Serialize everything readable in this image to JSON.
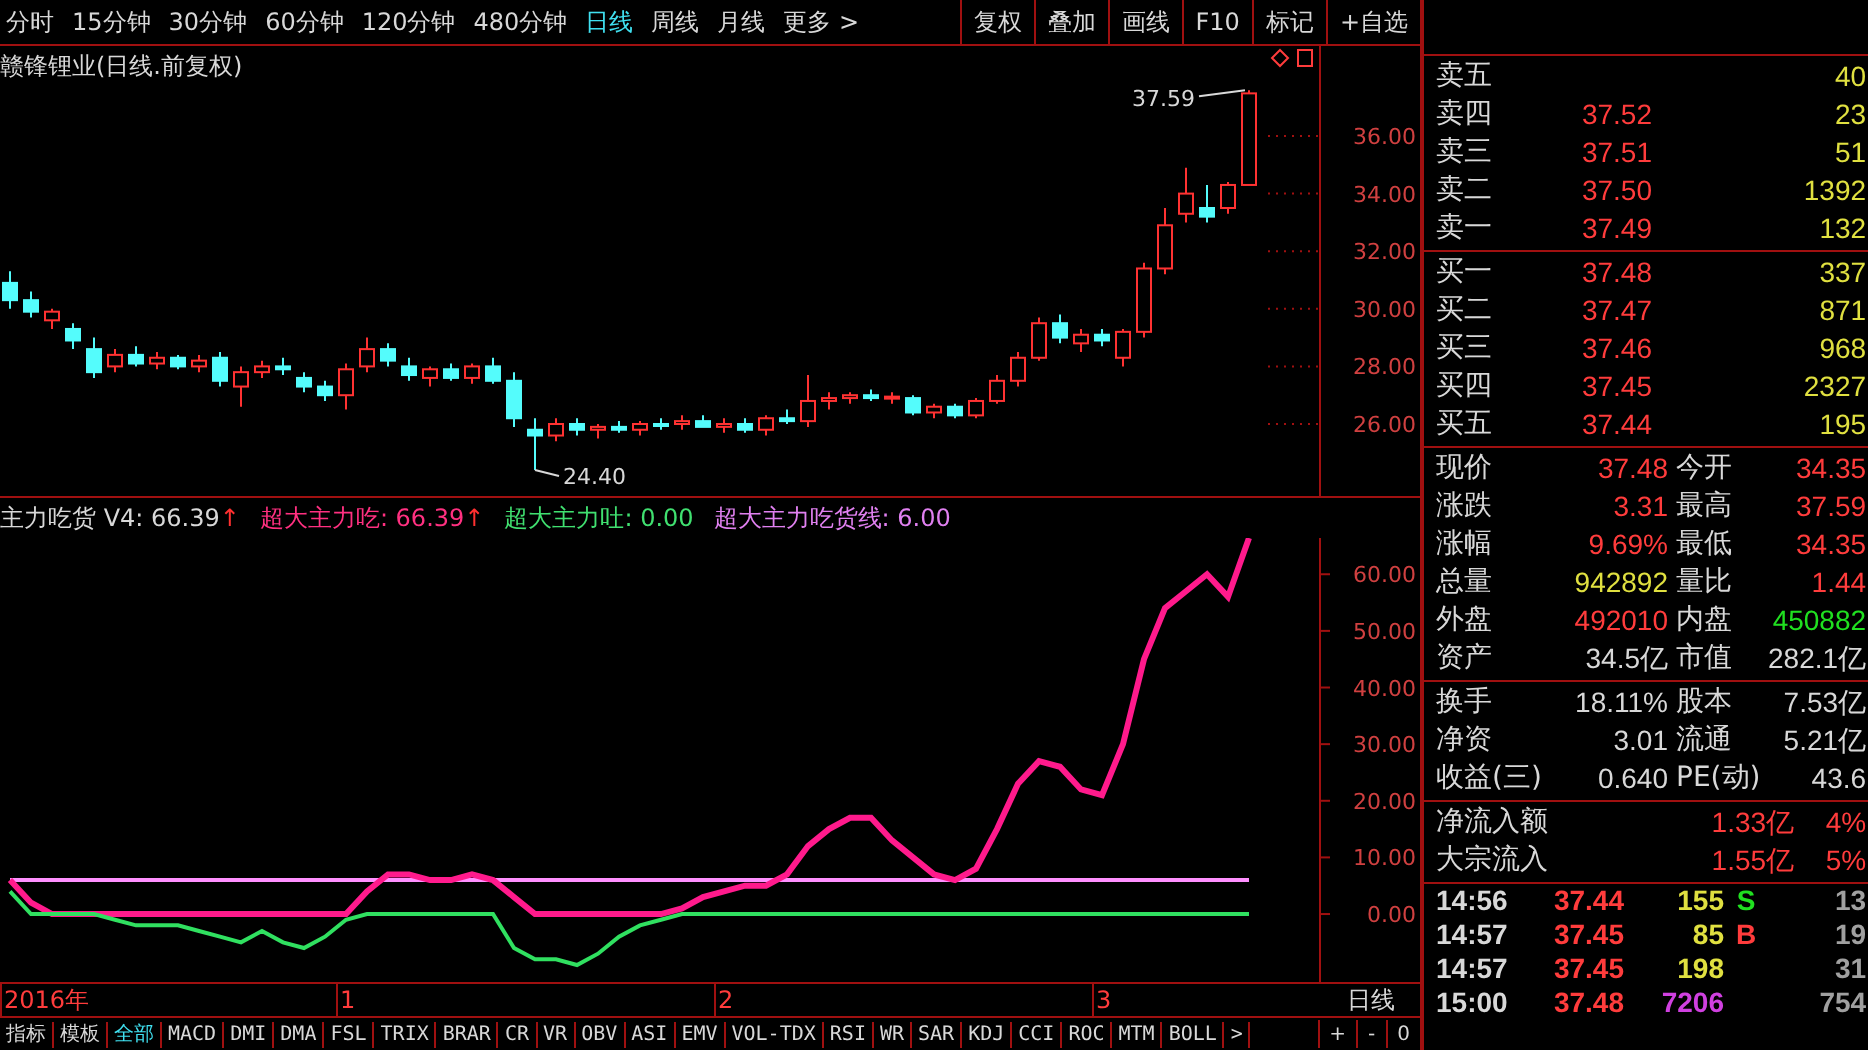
{
  "toolbar": {
    "periods": [
      {
        "label": "分时",
        "selected": false
      },
      {
        "label": "15分钟",
        "selected": false
      },
      {
        "label": "30分钟",
        "selected": false
      },
      {
        "label": "60分钟",
        "selected": false
      },
      {
        "label": "120分钟",
        "selected": false
      },
      {
        "label": "480分钟",
        "selected": false
      },
      {
        "label": "日线",
        "selected": true
      },
      {
        "label": "周线",
        "selected": false
      },
      {
        "label": "月线",
        "selected": false
      },
      {
        "label": "更多 >",
        "selected": false
      }
    ],
    "buttons": [
      "复权",
      "叠加",
      "画线",
      "F10",
      "标记",
      "+自选"
    ]
  },
  "main_chart": {
    "title": "赣锋锂业(日线.前复权)",
    "high_label": "37.59",
    "low_label": "24.40",
    "axis_labels": [
      "36.00",
      "34.00",
      "32.00",
      "30.00",
      "28.00",
      "26.00"
    ]
  },
  "indicator": {
    "legend": [
      {
        "text": "主力吃货 V4: 66.39",
        "arrow": "↑",
        "color": "#d8d8d8"
      },
      {
        "text": "超大主力吃: 66.39",
        "arrow": "↑",
        "color": "#ff3080"
      },
      {
        "text": "超大主力吐: 0.00",
        "color": "#40e070"
      },
      {
        "text": "超大主力吃货线: 6.00",
        "color": "#e080f0"
      }
    ],
    "chart_data": {
      "type": "line",
      "ylim": [
        -12,
        66.4
      ],
      "yticks": [
        {
          "value": 60,
          "label": "60.00"
        },
        {
          "value": 50,
          "label": "50.00"
        },
        {
          "value": 40,
          "label": "40.00"
        },
        {
          "value": 30,
          "label": "30.00"
        },
        {
          "value": 20,
          "label": "20.00"
        },
        {
          "value": 10,
          "label": "10.00"
        },
        {
          "value": 0,
          "label": "0.00"
        }
      ],
      "series": [
        {
          "color": "#ff90ff",
          "values": [
            6,
            6,
            6,
            6,
            6,
            6,
            6,
            6,
            6,
            6,
            6,
            6,
            6,
            6,
            6,
            6,
            6,
            6,
            6,
            6,
            6,
            6,
            6,
            6,
            6,
            6,
            6,
            6,
            6,
            6,
            6,
            6,
            6,
            6,
            6,
            6,
            6,
            6,
            6,
            6,
            6,
            6,
            6,
            6,
            6,
            6,
            6,
            6,
            6,
            6,
            6,
            6,
            6,
            6,
            6,
            6,
            6,
            6,
            6,
            6
          ]
        },
        {
          "color": "#ff1a8c",
          "values": [
            6,
            2,
            0,
            0,
            0,
            0,
            0,
            0,
            0,
            0,
            0,
            0,
            0,
            0,
            0,
            0,
            0,
            4,
            7,
            7,
            6,
            6,
            7,
            6,
            3,
            0,
            0,
            0,
            0,
            0,
            0,
            0,
            1,
            3,
            4,
            5,
            5,
            7,
            12,
            15,
            17,
            17,
            13,
            10,
            7,
            6,
            8,
            15,
            23,
            27,
            26,
            22,
            21,
            30,
            45,
            54,
            57,
            60,
            56,
            66.4
          ]
        },
        {
          "color": "#30e060",
          "values": [
            4,
            0,
            0,
            0,
            0,
            -1,
            -2,
            -2,
            -2,
            -3,
            -4,
            -5,
            -3,
            -5,
            -6,
            -4,
            -1,
            0,
            0,
            0,
            0,
            0,
            0,
            0,
            -6,
            -8,
            -8,
            -9,
            -7,
            -4,
            -2,
            -1,
            0,
            0,
            0,
            0,
            0,
            0,
            0,
            0,
            0,
            0,
            0,
            0,
            0,
            0,
            0,
            0,
            0,
            0,
            0,
            0,
            0,
            0,
            0,
            0,
            0,
            0,
            0,
            0
          ]
        }
      ]
    }
  },
  "date_axis": {
    "marks": [
      "2016年",
      "1",
      "2",
      "3"
    ],
    "period": "日线"
  },
  "indicator_tabs": [
    {
      "label": "指标",
      "selected": false
    },
    {
      "label": "模板",
      "selected": false
    },
    {
      "label": "全部",
      "selected": true
    },
    {
      "label": "MACD",
      "selected": false
    },
    {
      "label": "DMI",
      "selected": false
    },
    {
      "label": "DMA",
      "selected": false
    },
    {
      "label": "FSL",
      "selected": false
    },
    {
      "label": "TRIX",
      "selected": false
    },
    {
      "label": "BRAR",
      "selected": false
    },
    {
      "label": "CR",
      "selected": false
    },
    {
      "label": "VR",
      "selected": false
    },
    {
      "label": "OBV",
      "selected": false
    },
    {
      "label": "ASI",
      "selected": false
    },
    {
      "label": "EMV",
      "selected": false
    },
    {
      "label": "VOL-TDX",
      "selected": false
    },
    {
      "label": "RSI",
      "selected": false
    },
    {
      "label": "WR",
      "selected": false
    },
    {
      "label": "SAR",
      "selected": false
    },
    {
      "label": "KDJ",
      "selected": false
    },
    {
      "label": "CCI",
      "selected": false
    },
    {
      "label": "ROC",
      "selected": false
    },
    {
      "label": "MTM",
      "selected": false
    },
    {
      "label": "BOLL",
      "selected": false
    },
    {
      "label": ">",
      "selected": false
    }
  ],
  "zoom_buttons": [
    "+",
    "-",
    "0"
  ],
  "order_book": {
    "sell": [
      {
        "label": "卖五",
        "volume": "40"
      },
      {
        "label": "卖四",
        "price": "37.52",
        "volume": "23"
      },
      {
        "label": "卖三",
        "price": "37.51",
        "volume": "51"
      },
      {
        "label": "卖二",
        "price": "37.50",
        "volume": "1392"
      },
      {
        "label": "卖一",
        "price": "37.49",
        "volume": "132"
      }
    ],
    "buy": [
      {
        "label": "买一",
        "price": "37.48",
        "volume": "337"
      },
      {
        "label": "买二",
        "price": "37.47",
        "volume": "871"
      },
      {
        "label": "买三",
        "price": "37.46",
        "volume": "968"
      },
      {
        "label": "买四",
        "price": "37.45",
        "volume": "2327"
      },
      {
        "label": "买五",
        "price": "37.44",
        "volume": "195"
      }
    ]
  },
  "quote_sections": [
    [
      {
        "label": "现价",
        "value": "37.48",
        "kind": "up"
      },
      {
        "label": "今开",
        "value": "34.35",
        "kind": "up"
      },
      {
        "label": "涨跌",
        "value": "3.31",
        "kind": "up"
      },
      {
        "label": "最高",
        "value": "37.59",
        "kind": "up"
      },
      {
        "label": "涨幅",
        "value": "9.69%",
        "kind": "up"
      },
      {
        "label": "最低",
        "value": "34.35",
        "kind": "up"
      },
      {
        "label": "总量",
        "value": "942892",
        "kind": "volume"
      },
      {
        "label": "量比",
        "value": "1.44",
        "kind": "up"
      },
      {
        "label": "外盘",
        "value": "492010",
        "kind": "up"
      },
      {
        "label": "内盘",
        "value": "450882",
        "kind": "down"
      },
      {
        "label": "资产",
        "value": "34.5亿",
        "kind": "plain"
      },
      {
        "label": "市值",
        "value": "282.1亿",
        "kind": "plain"
      }
    ],
    [
      {
        "label": "换手",
        "value": "18.11%",
        "kind": "plain"
      },
      {
        "label": "股本",
        "value": "7.53亿",
        "kind": "plain"
      },
      {
        "label": "净资",
        "value": "3.01",
        "kind": "plain"
      },
      {
        "label": "流通",
        "value": "5.21亿",
        "kind": "plain"
      },
      {
        "label": "收益(三)",
        "value": "0.640",
        "kind": "plain"
      },
      {
        "label": "PE(动)",
        "value": "43.6",
        "kind": "plain"
      }
    ]
  ],
  "flows": [
    {
      "label": "净流入额",
      "value": "1.33亿",
      "share": "4%"
    },
    {
      "label": "大宗流入",
      "value": "1.55亿",
      "share": "5%"
    }
  ],
  "ticks": [
    {
      "time": "14:56",
      "price": "37.44",
      "volume": "155",
      "kind": "normal",
      "side": {
        "text": "S",
        "kind": "sell"
      },
      "count": "13"
    },
    {
      "time": "14:57",
      "price": "37.45",
      "volume": "85",
      "kind": "normal",
      "side": {
        "text": "B",
        "kind": "buy"
      },
      "count": "19"
    },
    {
      "time": "14:57",
      "price": "37.45",
      "volume": "198",
      "kind": "normal",
      "count": "31"
    },
    {
      "time": "15:00",
      "price": "37.48",
      "volume": "7206",
      "kind": "big",
      "count": "754"
    }
  ]
}
